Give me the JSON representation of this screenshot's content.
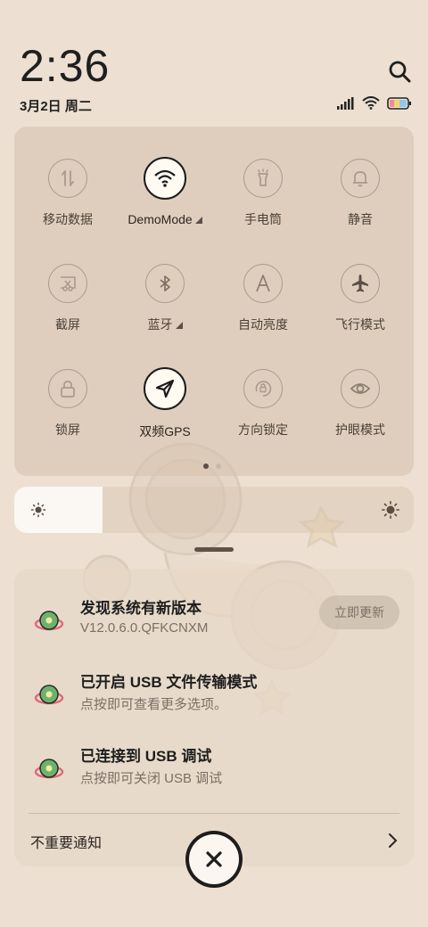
{
  "status_bar": {
    "time": "2:36",
    "date": "3月2日 周二",
    "icons": [
      "signal-icon",
      "wifi-icon",
      "battery-icon"
    ]
  },
  "quick_settings": {
    "tiles": [
      {
        "label": "移动数据",
        "icon": "mobile-data-icon",
        "active": false,
        "expandable": false
      },
      {
        "label": "DemoMode",
        "icon": "wifi-icon",
        "active": true,
        "expandable": true
      },
      {
        "label": "手电筒",
        "icon": "flashlight-icon",
        "active": false,
        "expandable": false
      },
      {
        "label": "静音",
        "icon": "bell-icon",
        "active": false,
        "expandable": false
      },
      {
        "label": "截屏",
        "icon": "screenshot-icon",
        "active": false,
        "expandable": false
      },
      {
        "label": "蓝牙",
        "icon": "bluetooth-icon",
        "active": false,
        "expandable": true
      },
      {
        "label": "自动亮度",
        "icon": "auto-brightness-icon",
        "active": false,
        "expandable": false
      },
      {
        "label": "飞行模式",
        "icon": "airplane-icon",
        "active": false,
        "expandable": false
      },
      {
        "label": "锁屏",
        "icon": "lock-icon",
        "active": false,
        "expandable": false
      },
      {
        "label": "双频GPS",
        "icon": "location-icon",
        "active": true,
        "expandable": false
      },
      {
        "label": "方向锁定",
        "icon": "rotation-lock-icon",
        "active": false,
        "expandable": false
      },
      {
        "label": "护眼模式",
        "icon": "eye-icon",
        "active": false,
        "expandable": false
      }
    ],
    "page_count": 2,
    "current_page": 1
  },
  "brightness": {
    "level": 0.22
  },
  "notifications": {
    "items": [
      {
        "title": "发现系统有新版本",
        "subtitle": "V12.0.6.0.QFKCNXM",
        "action": "立即更新"
      },
      {
        "title": "已开启 USB 文件传输模式",
        "subtitle": "点按即可查看更多选项。"
      },
      {
        "title": "已连接到 USB 调试",
        "subtitle": "点按即可关闭 USB 调试"
      }
    ],
    "footer": "不重要通知"
  },
  "colors": {
    "background": "#ede0d2",
    "panel": "#d6c4b0",
    "accent_dark": "#1d1d1d"
  }
}
